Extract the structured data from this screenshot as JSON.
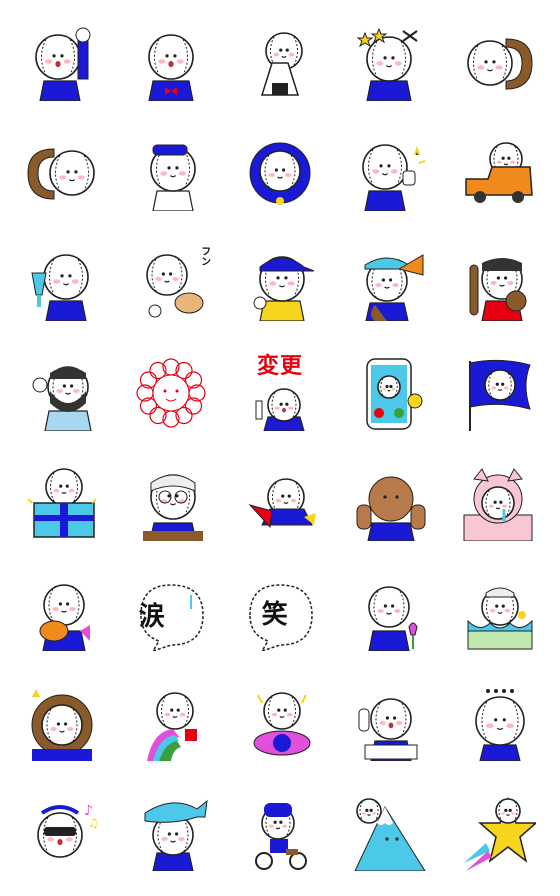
{
  "stickers": [
    {
      "id": 1,
      "name": "fist-pump",
      "text": ""
    },
    {
      "id": 2,
      "name": "bow-tie-salute",
      "text": ""
    },
    {
      "id": 3,
      "name": "rice-ball",
      "text": ""
    },
    {
      "id": 4,
      "name": "stars-scissors",
      "text": ""
    },
    {
      "id": 5,
      "name": "peek-right",
      "text": ""
    },
    {
      "id": 6,
      "name": "peek-left",
      "text": ""
    },
    {
      "id": 7,
      "name": "salute",
      "text": ""
    },
    {
      "id": 8,
      "name": "round-blue",
      "text": ""
    },
    {
      "id": 9,
      "name": "thumbs-up",
      "text": ""
    },
    {
      "id": 10,
      "name": "car-driver",
      "text": ""
    },
    {
      "id": 11,
      "name": "drink-toast",
      "text": ""
    },
    {
      "id": 12,
      "name": "sniff-dog",
      "text": "フン"
    },
    {
      "id": 13,
      "name": "cap-player",
      "text": ""
    },
    {
      "id": 14,
      "name": "megaphone-cheer",
      "text": ""
    },
    {
      "id": 15,
      "name": "bat-glove",
      "text": ""
    },
    {
      "id": 16,
      "name": "bearded-man",
      "text": ""
    },
    {
      "id": 17,
      "name": "flower-stamp",
      "text": ""
    },
    {
      "id": 18,
      "name": "change-label",
      "text": "変更"
    },
    {
      "id": 19,
      "name": "phone-call",
      "text": ""
    },
    {
      "id": 20,
      "name": "waving-flag",
      "text": ""
    },
    {
      "id": 21,
      "name": "gift-box",
      "text": ""
    },
    {
      "id": 22,
      "name": "bandaged-head",
      "text": ""
    },
    {
      "id": 23,
      "name": "super-hero",
      "text": ""
    },
    {
      "id": 24,
      "name": "muscle-arm",
      "text": ""
    },
    {
      "id": 25,
      "name": "pig-crying",
      "text": ""
    },
    {
      "id": 26,
      "name": "bearded-hands",
      "text": ""
    },
    {
      "id": 27,
      "name": "tears-bubble",
      "text": "涙"
    },
    {
      "id": 28,
      "name": "laugh-bubble",
      "text": "笑"
    },
    {
      "id": 29,
      "name": "tulip-sit",
      "text": ""
    },
    {
      "id": 30,
      "name": "melted-cake",
      "text": ""
    },
    {
      "id": 31,
      "name": "king-crown",
      "text": ""
    },
    {
      "id": 32,
      "name": "rainbow-hug",
      "text": ""
    },
    {
      "id": 33,
      "name": "flower-bath",
      "text": ""
    },
    {
      "id": 34,
      "name": "stretch",
      "text": ""
    },
    {
      "id": 35,
      "name": "thinking-dots",
      "text": ""
    },
    {
      "id": 36,
      "name": "sunglasses-singer",
      "text": ""
    },
    {
      "id": 37,
      "name": "fish-hat",
      "text": ""
    },
    {
      "id": 38,
      "name": "biker",
      "text": ""
    },
    {
      "id": 39,
      "name": "mount-fuji",
      "text": ""
    },
    {
      "id": 40,
      "name": "star-ride",
      "text": ""
    }
  ],
  "colors": {
    "blue": "#1a1ad6",
    "cheek": "#ffb7c0",
    "outline": "#222222",
    "red": "#e60012",
    "cyan": "#4cc8e8",
    "yellow": "#f7d51d",
    "orange": "#f08a1c",
    "brown": "#8a5a2b",
    "pink": "#f9c7d3"
  }
}
